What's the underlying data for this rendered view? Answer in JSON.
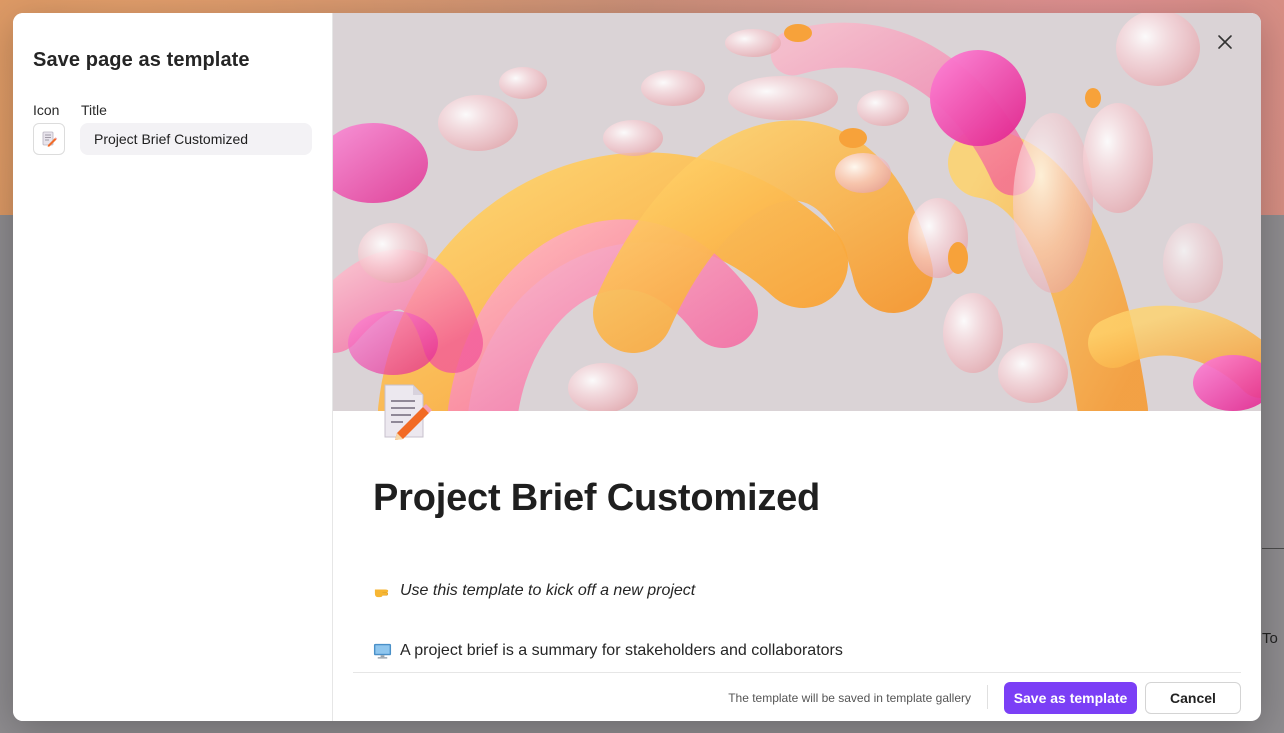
{
  "backdrop": {
    "edge_text": "To"
  },
  "dialog": {
    "title": "Save page as template",
    "icon_label": "Icon",
    "title_label": "Title",
    "title_value": "Project Brief Customized"
  },
  "preview": {
    "cover_image": "abstract-glass-shapes",
    "page_icon": "memo-pencil-icon",
    "page_title": "Project Brief Customized",
    "lines": [
      {
        "icon": "pointing-hand-icon",
        "text": "Use this template to kick off a new project"
      },
      {
        "icon": "computer-monitor-icon",
        "text": "A project brief is a summary for stakeholders and collaborators"
      }
    ]
  },
  "footer": {
    "note": "The template will be saved in template gallery",
    "save_label": "Save as template",
    "cancel_label": "Cancel"
  },
  "colors": {
    "accent": "#7B3FF6",
    "title_input_bg": "#F3F2F5"
  }
}
